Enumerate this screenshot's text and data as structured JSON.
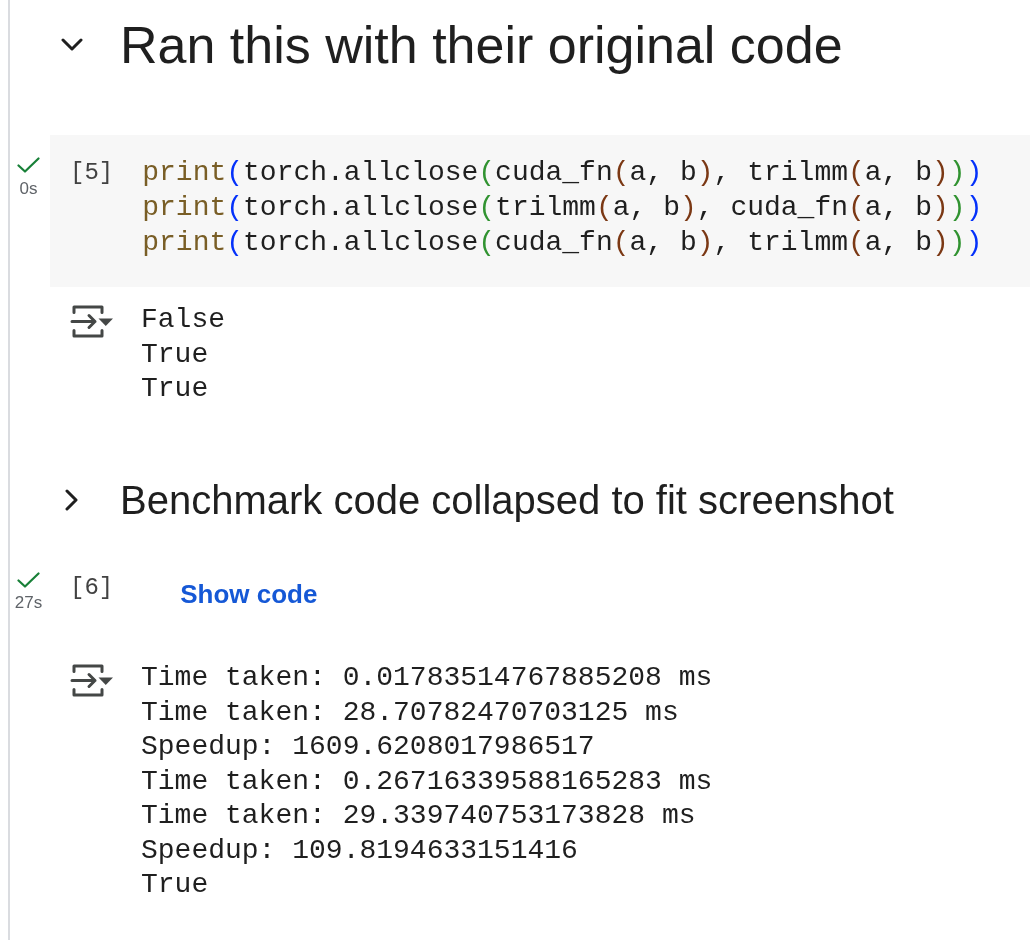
{
  "cells": [
    {
      "kind": "heading",
      "expanded": true,
      "text": "Ran this with their original code"
    },
    {
      "kind": "code",
      "succeeded": true,
      "duration": "0s",
      "execution_count": "[5]",
      "lines": [
        [
          {
            "text": "print",
            "kind": "builtin"
          },
          {
            "text": "(",
            "kind": "outer"
          },
          {
            "text": "torch.allclose",
            "kind": "plain"
          },
          {
            "text": "(",
            "kind": "middle"
          },
          {
            "text": "cuda_fn",
            "kind": "plain"
          },
          {
            "text": "(",
            "kind": "inner"
          },
          {
            "text": "a, b",
            "kind": "plain"
          },
          {
            "text": ")",
            "kind": "inner"
          },
          {
            "text": ", trilmm",
            "kind": "plain"
          },
          {
            "text": "(",
            "kind": "inner"
          },
          {
            "text": "a, b",
            "kind": "plain"
          },
          {
            "text": ")",
            "kind": "inner"
          },
          {
            "text": ")",
            "kind": "middle"
          },
          {
            "text": ")",
            "kind": "outer"
          }
        ],
        [
          {
            "text": "print",
            "kind": "builtin"
          },
          {
            "text": "(",
            "kind": "outer"
          },
          {
            "text": "torch.allclose",
            "kind": "plain"
          },
          {
            "text": "(",
            "kind": "middle"
          },
          {
            "text": "trilmm",
            "kind": "plain"
          },
          {
            "text": "(",
            "kind": "inner"
          },
          {
            "text": "a, b",
            "kind": "plain"
          },
          {
            "text": ")",
            "kind": "inner"
          },
          {
            "text": ", cuda_fn",
            "kind": "plain"
          },
          {
            "text": "(",
            "kind": "inner"
          },
          {
            "text": "a, b",
            "kind": "plain"
          },
          {
            "text": ")",
            "kind": "inner"
          },
          {
            "text": ")",
            "kind": "middle"
          },
          {
            "text": ")",
            "kind": "outer"
          }
        ],
        [
          {
            "text": "print",
            "kind": "builtin"
          },
          {
            "text": "(",
            "kind": "outer"
          },
          {
            "text": "torch.allclose",
            "kind": "plain"
          },
          {
            "text": "(",
            "kind": "middle"
          },
          {
            "text": "cuda_fn",
            "kind": "plain"
          },
          {
            "text": "(",
            "kind": "inner"
          },
          {
            "text": "a, b",
            "kind": "plain"
          },
          {
            "text": ")",
            "kind": "inner"
          },
          {
            "text": ", trilmm",
            "kind": "plain"
          },
          {
            "text": "(",
            "kind": "inner"
          },
          {
            "text": "a, b",
            "kind": "plain"
          },
          {
            "text": ")",
            "kind": "inner"
          },
          {
            "text": ")",
            "kind": "middle"
          },
          {
            "text": ")",
            "kind": "outer"
          }
        ]
      ],
      "output": [
        "False",
        "True",
        "True"
      ]
    },
    {
      "kind": "subheading",
      "expanded": false,
      "text": "Benchmark code collapsed to fit screenshot"
    },
    {
      "kind": "form",
      "succeeded": true,
      "duration": "27s",
      "execution_count": "[6]",
      "link": "Show code",
      "output": [
        "Time taken: 0.01783514767885208 ms",
        "Time taken: 28.70782470703125 ms",
        "Speedup: 1609.6208017986517",
        "Time taken: 0.26716339588165283 ms",
        "Time taken: 29.339740753173828 ms",
        "Speedup: 109.8194633151416",
        "True"
      ]
    }
  ]
}
